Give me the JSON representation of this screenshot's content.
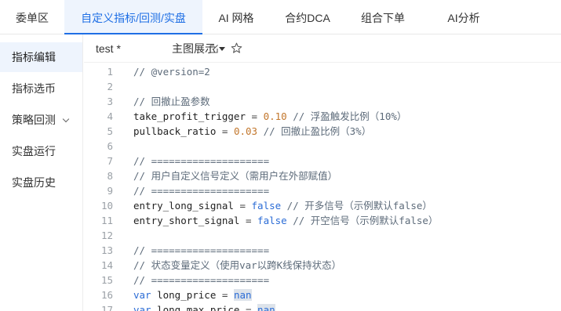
{
  "tabs": [
    {
      "label": "委单区",
      "active": false
    },
    {
      "label": "自定义指标/回测/实盘",
      "active": true
    },
    {
      "label": "AI 网格",
      "active": false
    },
    {
      "label": "合约DCA",
      "active": false
    },
    {
      "label": "组合下单",
      "active": false
    },
    {
      "label": "AI分析",
      "active": false
    }
  ],
  "sidebar": {
    "items": [
      {
        "label": "指标编辑",
        "active": true
      },
      {
        "label": "指标选币",
        "active": false
      },
      {
        "label": "策略回测",
        "active": false,
        "has_dropdown": true
      },
      {
        "label": "实盘运行",
        "active": false
      },
      {
        "label": "实盘历史",
        "active": false
      }
    ]
  },
  "toolbar": {
    "file_name": "test *",
    "edit_icon": "edit-icon",
    "star_icon": "star-icon",
    "view_label": "主图展示"
  },
  "editor": {
    "lines": [
      {
        "n": "1",
        "parts": [
          {
            "t": "// @version=2",
            "c": "cmt"
          }
        ]
      },
      {
        "n": "2",
        "parts": []
      },
      {
        "n": "3",
        "parts": [
          {
            "t": "// 回撤止盈参数",
            "c": "cmt"
          }
        ]
      },
      {
        "n": "4",
        "parts": [
          {
            "t": "take_profit_trigger",
            "c": "id"
          },
          {
            "t": " = ",
            "c": "op"
          },
          {
            "t": "0.10",
            "c": "num"
          },
          {
            "t": " // 浮盈触发比例（10%）",
            "c": "cmt"
          }
        ]
      },
      {
        "n": "5",
        "parts": [
          {
            "t": "pullback_ratio",
            "c": "id"
          },
          {
            "t": " = ",
            "c": "op"
          },
          {
            "t": "0.03",
            "c": "num"
          },
          {
            "t": " // 回撤止盈比例（3%）",
            "c": "cmt"
          }
        ]
      },
      {
        "n": "6",
        "parts": []
      },
      {
        "n": "7",
        "parts": [
          {
            "t": "// ====================",
            "c": "cmt"
          }
        ]
      },
      {
        "n": "8",
        "parts": [
          {
            "t": "// 用户自定义信号定义（需用户在外部赋值）",
            "c": "cmt"
          }
        ]
      },
      {
        "n": "9",
        "parts": [
          {
            "t": "// ====================",
            "c": "cmt"
          }
        ]
      },
      {
        "n": "10",
        "parts": [
          {
            "t": "entry_long_signal",
            "c": "id"
          },
          {
            "t": " = ",
            "c": "op"
          },
          {
            "t": "false",
            "c": "kw"
          },
          {
            "t": " // 开多信号（示例默认false）",
            "c": "cmt"
          }
        ]
      },
      {
        "n": "11",
        "parts": [
          {
            "t": "entry_short_signal",
            "c": "id"
          },
          {
            "t": " = ",
            "c": "op"
          },
          {
            "t": "false",
            "c": "kw"
          },
          {
            "t": " // 开空信号（示例默认false）",
            "c": "cmt"
          }
        ]
      },
      {
        "n": "12",
        "parts": []
      },
      {
        "n": "13",
        "parts": [
          {
            "t": "// ====================",
            "c": "cmt"
          }
        ]
      },
      {
        "n": "14",
        "parts": [
          {
            "t": "// 状态变量定义（使用var以跨K线保持状态）",
            "c": "cmt"
          }
        ]
      },
      {
        "n": "15",
        "parts": [
          {
            "t": "// ====================",
            "c": "cmt"
          }
        ]
      },
      {
        "n": "16",
        "parts": [
          {
            "t": "var",
            "c": "kw"
          },
          {
            "t": " long_price",
            "c": "id"
          },
          {
            "t": " = ",
            "c": "op"
          },
          {
            "t": "nan",
            "c": "kw hl"
          }
        ]
      },
      {
        "n": "17",
        "parts": [
          {
            "t": "var",
            "c": "kw"
          },
          {
            "t": " long_max_price",
            "c": "id"
          },
          {
            "t": " = ",
            "c": "op"
          },
          {
            "t": "nan",
            "c": "kw hl"
          }
        ]
      }
    ]
  },
  "colors": {
    "accent": "#1f6fe5",
    "active_bg": "#eef4fd",
    "comment": "#5d6b7a",
    "number": "#c2762b",
    "keyword": "#2b6cd6"
  }
}
